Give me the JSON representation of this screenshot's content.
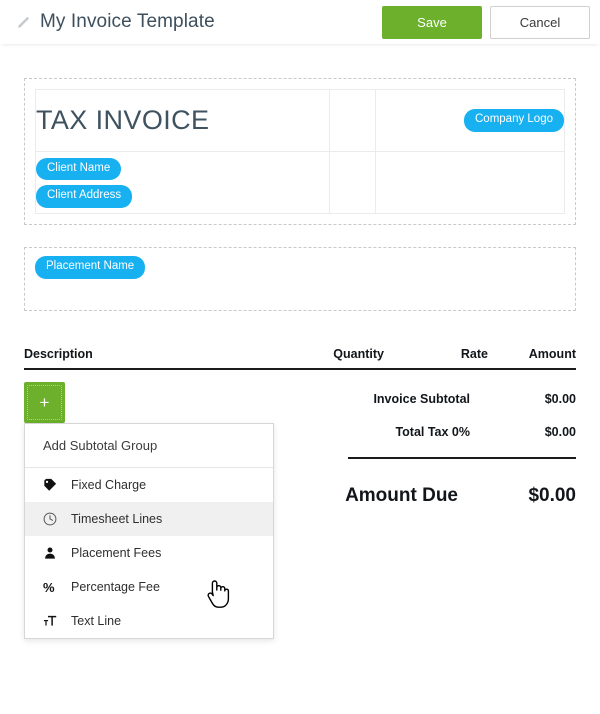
{
  "header": {
    "edit_icon": "pencil-icon",
    "title": "My Invoice Template",
    "save_label": "Save",
    "cancel_label": "Cancel",
    "save_color": "#6cb02c"
  },
  "invoice_header": {
    "title": "TAX INVOICE",
    "logo_pill": "Company Logo",
    "client_pills": [
      "Client Name",
      "Client Address"
    ],
    "pill_color": "#17b0f0"
  },
  "placement_section": {
    "pill": "Placement Name"
  },
  "line_columns": {
    "description": "Description",
    "quantity": "Quantity",
    "rate": "Rate",
    "amount": "Amount"
  },
  "add_button": {
    "label": "+",
    "icon": "plus-icon"
  },
  "menu": {
    "head_label": "Add Subtotal Group",
    "items": [
      {
        "label": "Fixed Charge",
        "icon": "tag-icon",
        "hover": false
      },
      {
        "label": "Timesheet Lines",
        "icon": "clock-icon",
        "hover": true
      },
      {
        "label": "Placement Fees",
        "icon": "person-icon",
        "hover": false
      },
      {
        "label": "Percentage Fee",
        "icon": "percent-icon",
        "hover": false
      },
      {
        "label": "Text Line",
        "icon": "text-icon",
        "hover": false
      }
    ]
  },
  "totals": {
    "rows": [
      {
        "label": "Invoice Subtotal",
        "value": "$0.00"
      },
      {
        "label": "Total Tax 0%",
        "value": "$0.00"
      }
    ],
    "grand_label": "Amount Due",
    "grand_value": "$0.00"
  },
  "cursor": {
    "type": "pointing-hand-cursor"
  }
}
